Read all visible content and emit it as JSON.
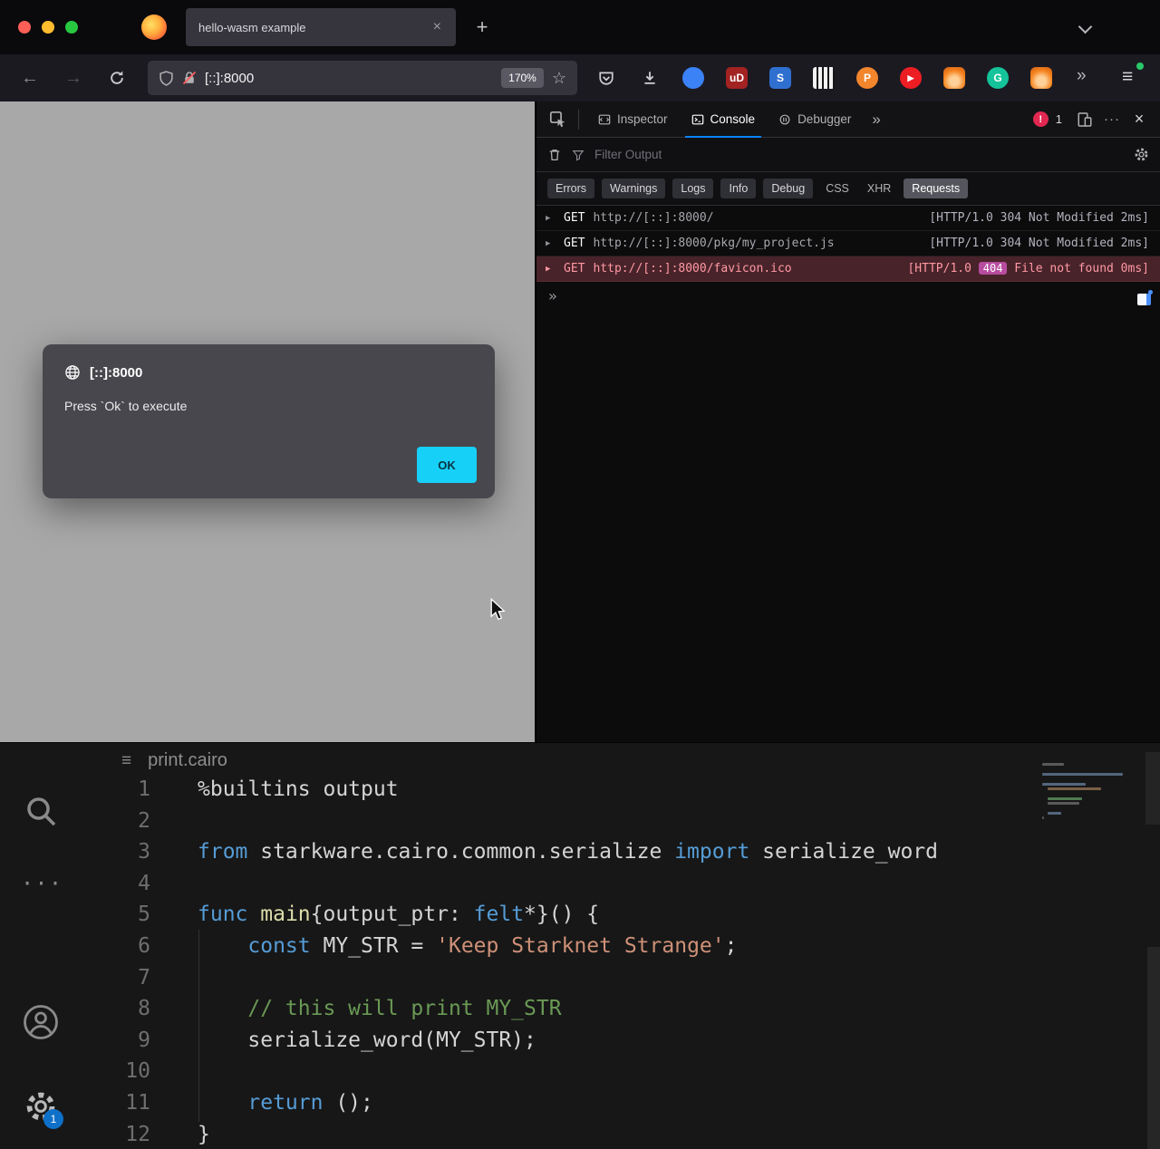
{
  "icons": {
    "close": "×",
    "new_tab": "+",
    "back": "←",
    "forward": "→",
    "star": "☆",
    "overflow": "»",
    "menu": "≡",
    "more": "···",
    "caret": "▶",
    "prompt": "»",
    "hamburger": "≡"
  },
  "titlebar": {
    "tab_title": "hello-wasm example"
  },
  "navbar": {
    "url": "[::]:8000",
    "zoom": "170%",
    "extensions": [
      {
        "name": "containers-icon",
        "shape": "circle",
        "bg": "#3b82f6",
        "glyph": ""
      },
      {
        "name": "ublock-icon",
        "shape": "square",
        "bg": "#a32222",
        "glyph": "uD",
        "color": "#fff"
      },
      {
        "name": "s-extension-icon",
        "shape": "square",
        "bg": "#2f6fd0",
        "glyph": "S",
        "color": "#fff"
      },
      {
        "name": "piano-icon",
        "shape": "square",
        "cls": "piano",
        "glyph": ""
      },
      {
        "name": "p-extension-icon",
        "shape": "circle",
        "bg": "#f2862c",
        "glyph": "P",
        "color": "#fff"
      },
      {
        "name": "youtube-icon",
        "shape": "circle",
        "bg": "#ed1d24",
        "glyph": "▶",
        "color": "#fff"
      },
      {
        "name": "metamask-fox-icon",
        "shape": "circle",
        "cls": "fox",
        "glyph": ""
      },
      {
        "name": "grammarly-icon",
        "shape": "circle",
        "bg": "#15c39a",
        "glyph": "G",
        "color": "#fff"
      },
      {
        "name": "fox-extension-icon",
        "shape": "circle",
        "cls": "fox",
        "glyph": ""
      }
    ]
  },
  "dialog": {
    "origin": "[::]:8000",
    "message": "Press `Ok` to execute",
    "ok_label": "OK"
  },
  "devtools": {
    "tabs": [
      "Inspector",
      "Console",
      "Debugger"
    ],
    "error_count": "1",
    "filter_placeholder": "Filter Output",
    "filters": [
      {
        "label": "Errors",
        "style": "pill"
      },
      {
        "label": "Warnings",
        "style": "pill"
      },
      {
        "label": "Logs",
        "style": "pill"
      },
      {
        "label": "Info",
        "style": "pill"
      },
      {
        "label": "Debug",
        "style": "pill"
      },
      {
        "label": "CSS",
        "style": "plain"
      },
      {
        "label": "XHR",
        "style": "plain"
      },
      {
        "label": "Requests",
        "style": "active"
      }
    ],
    "requests": [
      {
        "method": "GET",
        "url": "http://[::]:8000/",
        "status": "[HTTP/1.0 304 Not Modified 2ms]",
        "error": false
      },
      {
        "method": "GET",
        "url": "http://[::]:8000/pkg/my_project.js",
        "status": "[HTTP/1.0 304 Not Modified 2ms]",
        "error": false
      },
      {
        "method": "GET",
        "url": "http://[::]:8000/favicon.ico",
        "status_prefix": "[HTTP/1.0 ",
        "badge": "404",
        "status_suffix": " File not found 0ms]",
        "error": true
      }
    ],
    "prompt": "»"
  },
  "editor": {
    "filename": "print.cairo",
    "badge": "1",
    "lines": [
      {
        "num": "1",
        "tokens": [
          {
            "t": "p",
            "s": "%builtins output"
          }
        ]
      },
      {
        "num": "2",
        "tokens": []
      },
      {
        "num": "3",
        "tokens": [
          {
            "t": "k",
            "s": "from"
          },
          {
            "t": "p",
            "s": " starkware.cairo.common.serialize "
          },
          {
            "t": "k",
            "s": "import"
          },
          {
            "t": "p",
            "s": " serialize_word"
          }
        ]
      },
      {
        "num": "4",
        "tokens": []
      },
      {
        "num": "5",
        "tokens": [
          {
            "t": "k",
            "s": "func"
          },
          {
            "t": "p",
            "s": " "
          },
          {
            "t": "f",
            "s": "main"
          },
          {
            "t": "p",
            "s": "{output_ptr: "
          },
          {
            "t": "t",
            "s": "felt"
          },
          {
            "t": "p",
            "s": "*}() {"
          }
        ]
      },
      {
        "num": "6",
        "tokens": [
          {
            "t": "p",
            "s": "    "
          },
          {
            "t": "k",
            "s": "const"
          },
          {
            "t": "p",
            "s": " MY_STR = "
          },
          {
            "t": "s",
            "s": "'Keep Starknet Strange'"
          },
          {
            "t": "p",
            "s": ";"
          }
        ]
      },
      {
        "num": "7",
        "tokens": []
      },
      {
        "num": "8",
        "tokens": [
          {
            "t": "p",
            "s": "    "
          },
          {
            "t": "c",
            "s": "// this will print MY_STR"
          }
        ]
      },
      {
        "num": "9",
        "tokens": [
          {
            "t": "p",
            "s": "    serialize_word(MY_STR);"
          }
        ]
      },
      {
        "num": "10",
        "tokens": []
      },
      {
        "num": "11",
        "tokens": [
          {
            "t": "p",
            "s": "    "
          },
          {
            "t": "k",
            "s": "return"
          },
          {
            "t": "p",
            "s": " ();"
          }
        ]
      },
      {
        "num": "12",
        "tokens": [
          {
            "t": "p",
            "s": "}"
          }
        ]
      }
    ]
  }
}
